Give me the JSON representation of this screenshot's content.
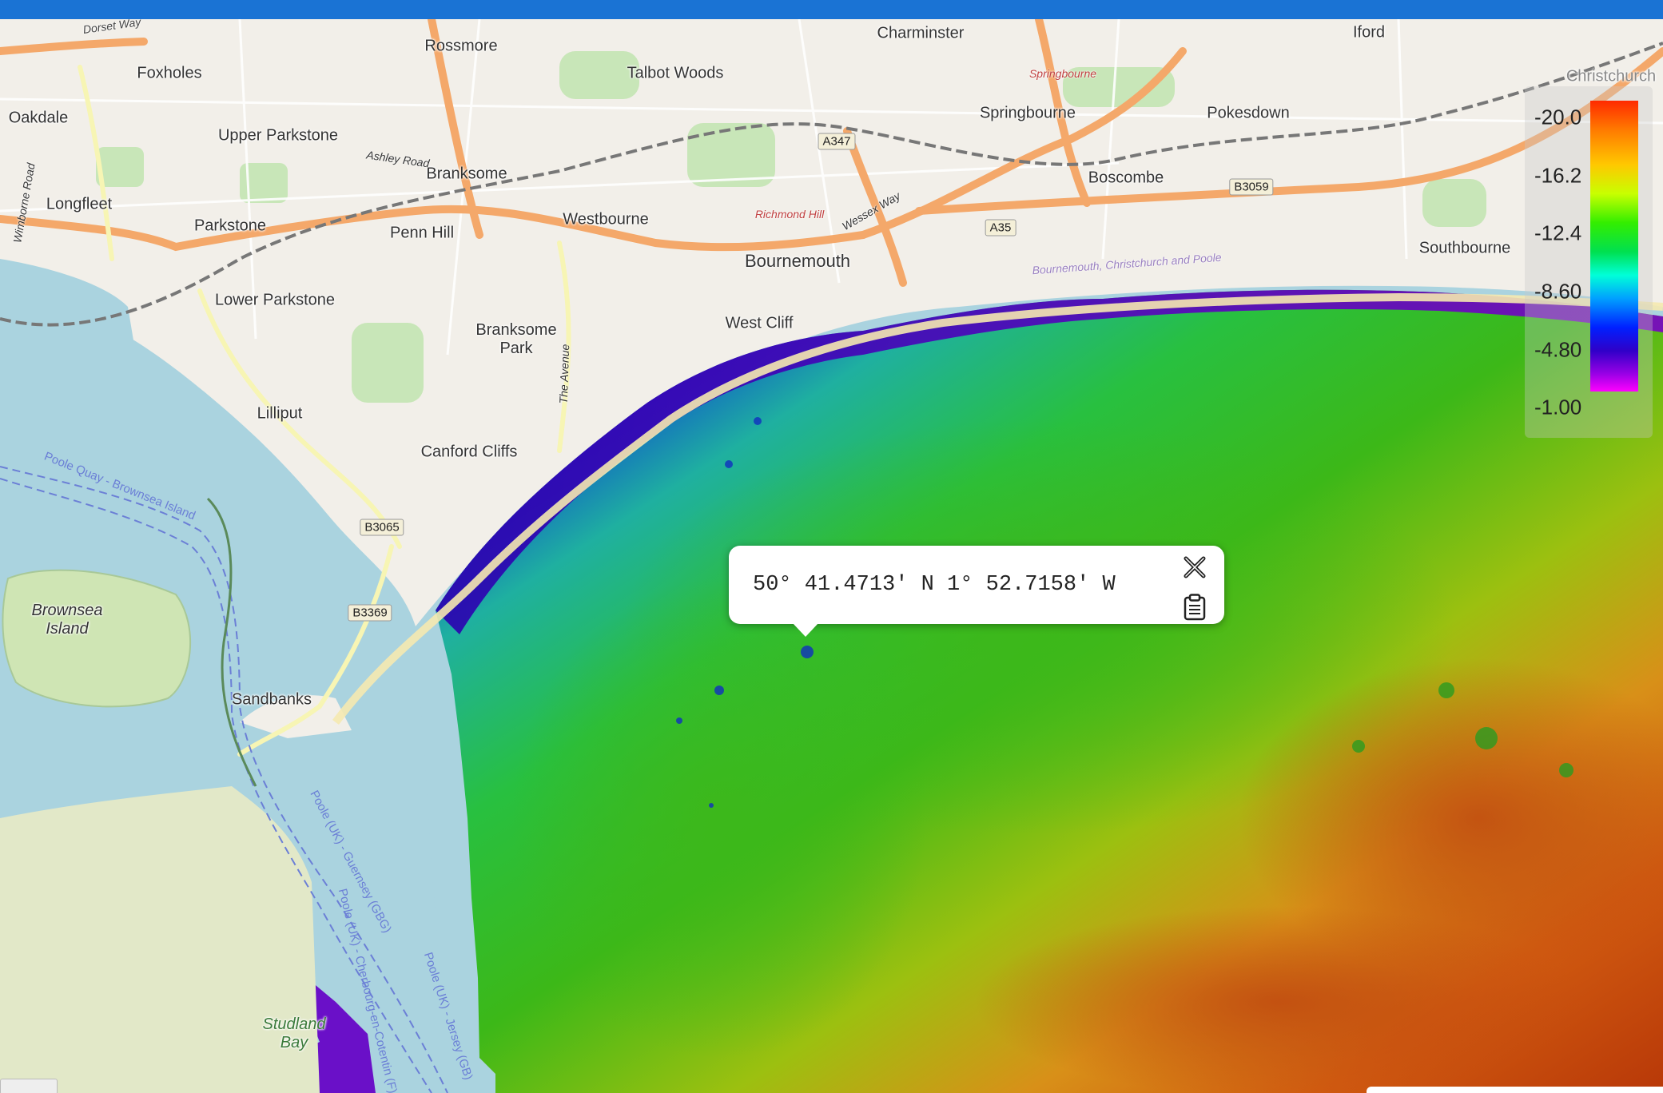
{
  "map": {
    "places": [
      {
        "name": "Charminster"
      },
      {
        "name": "Iford"
      },
      {
        "name": "Rossmore"
      },
      {
        "name": "Foxholes"
      },
      {
        "name": "Talbot Woods"
      },
      {
        "name": "Oakdale"
      },
      {
        "name": "Upper Parkstone"
      },
      {
        "name": "Springbourne"
      },
      {
        "name": "Pokesdown"
      },
      {
        "name": "Branksome"
      },
      {
        "name": "Longfleet"
      },
      {
        "name": "Westbourne"
      },
      {
        "name": "Boscombe"
      },
      {
        "name": "Parkstone"
      },
      {
        "name": "Penn Hill"
      },
      {
        "name": "Bournemouth"
      },
      {
        "name": "Southbourne"
      },
      {
        "name": "Lower Parkstone"
      },
      {
        "name": "West Cliff"
      },
      {
        "name": "Branksome Park"
      },
      {
        "name": "Lilliput"
      },
      {
        "name": "Canford Cliffs"
      },
      {
        "name": "Brownsea Island"
      },
      {
        "name": "Sandbanks"
      },
      {
        "name": "Christchurch"
      },
      {
        "name": "Studland Bay"
      }
    ],
    "road_labels": [
      {
        "text": "Ashley Road"
      },
      {
        "text": "Richmond Hill"
      },
      {
        "text": "Wessex Way"
      },
      {
        "text": "Springbourne"
      },
      {
        "text": "Dorset Way"
      },
      {
        "text": "Bournemouth, Christchurch and Poole"
      },
      {
        "text": "The Avenue"
      },
      {
        "text": "Wimborne Road"
      }
    ],
    "road_shields": [
      "A347",
      "A35",
      "B3059",
      "B3065",
      "B3369"
    ],
    "ferry_routes": [
      {
        "text": "Poole Quay - Brownsea Island"
      },
      {
        "text": "Poole (UK) - Guernsey (GBG)"
      },
      {
        "text": "Poole (UK) - Cherbourg-en-Cotentin (F)"
      },
      {
        "text": "Poole (UK) - Jersey (GB)"
      }
    ]
  },
  "legend": {
    "labels": [
      "-20.0",
      "-16.2",
      "-12.4",
      "-8.60",
      "-4.80",
      "-1.00"
    ],
    "color_top": "#ff2a00",
    "color_bottom": "#ff00ff"
  },
  "popup": {
    "coordinates": "50° 41.4713' N 1° 52.7158' W",
    "close_icon": "close-x-icon",
    "copy_icon": "clipboard-icon"
  },
  "colors": {
    "header": "#1a73d4",
    "water": "#aad3df",
    "land": "#f2efe9"
  }
}
